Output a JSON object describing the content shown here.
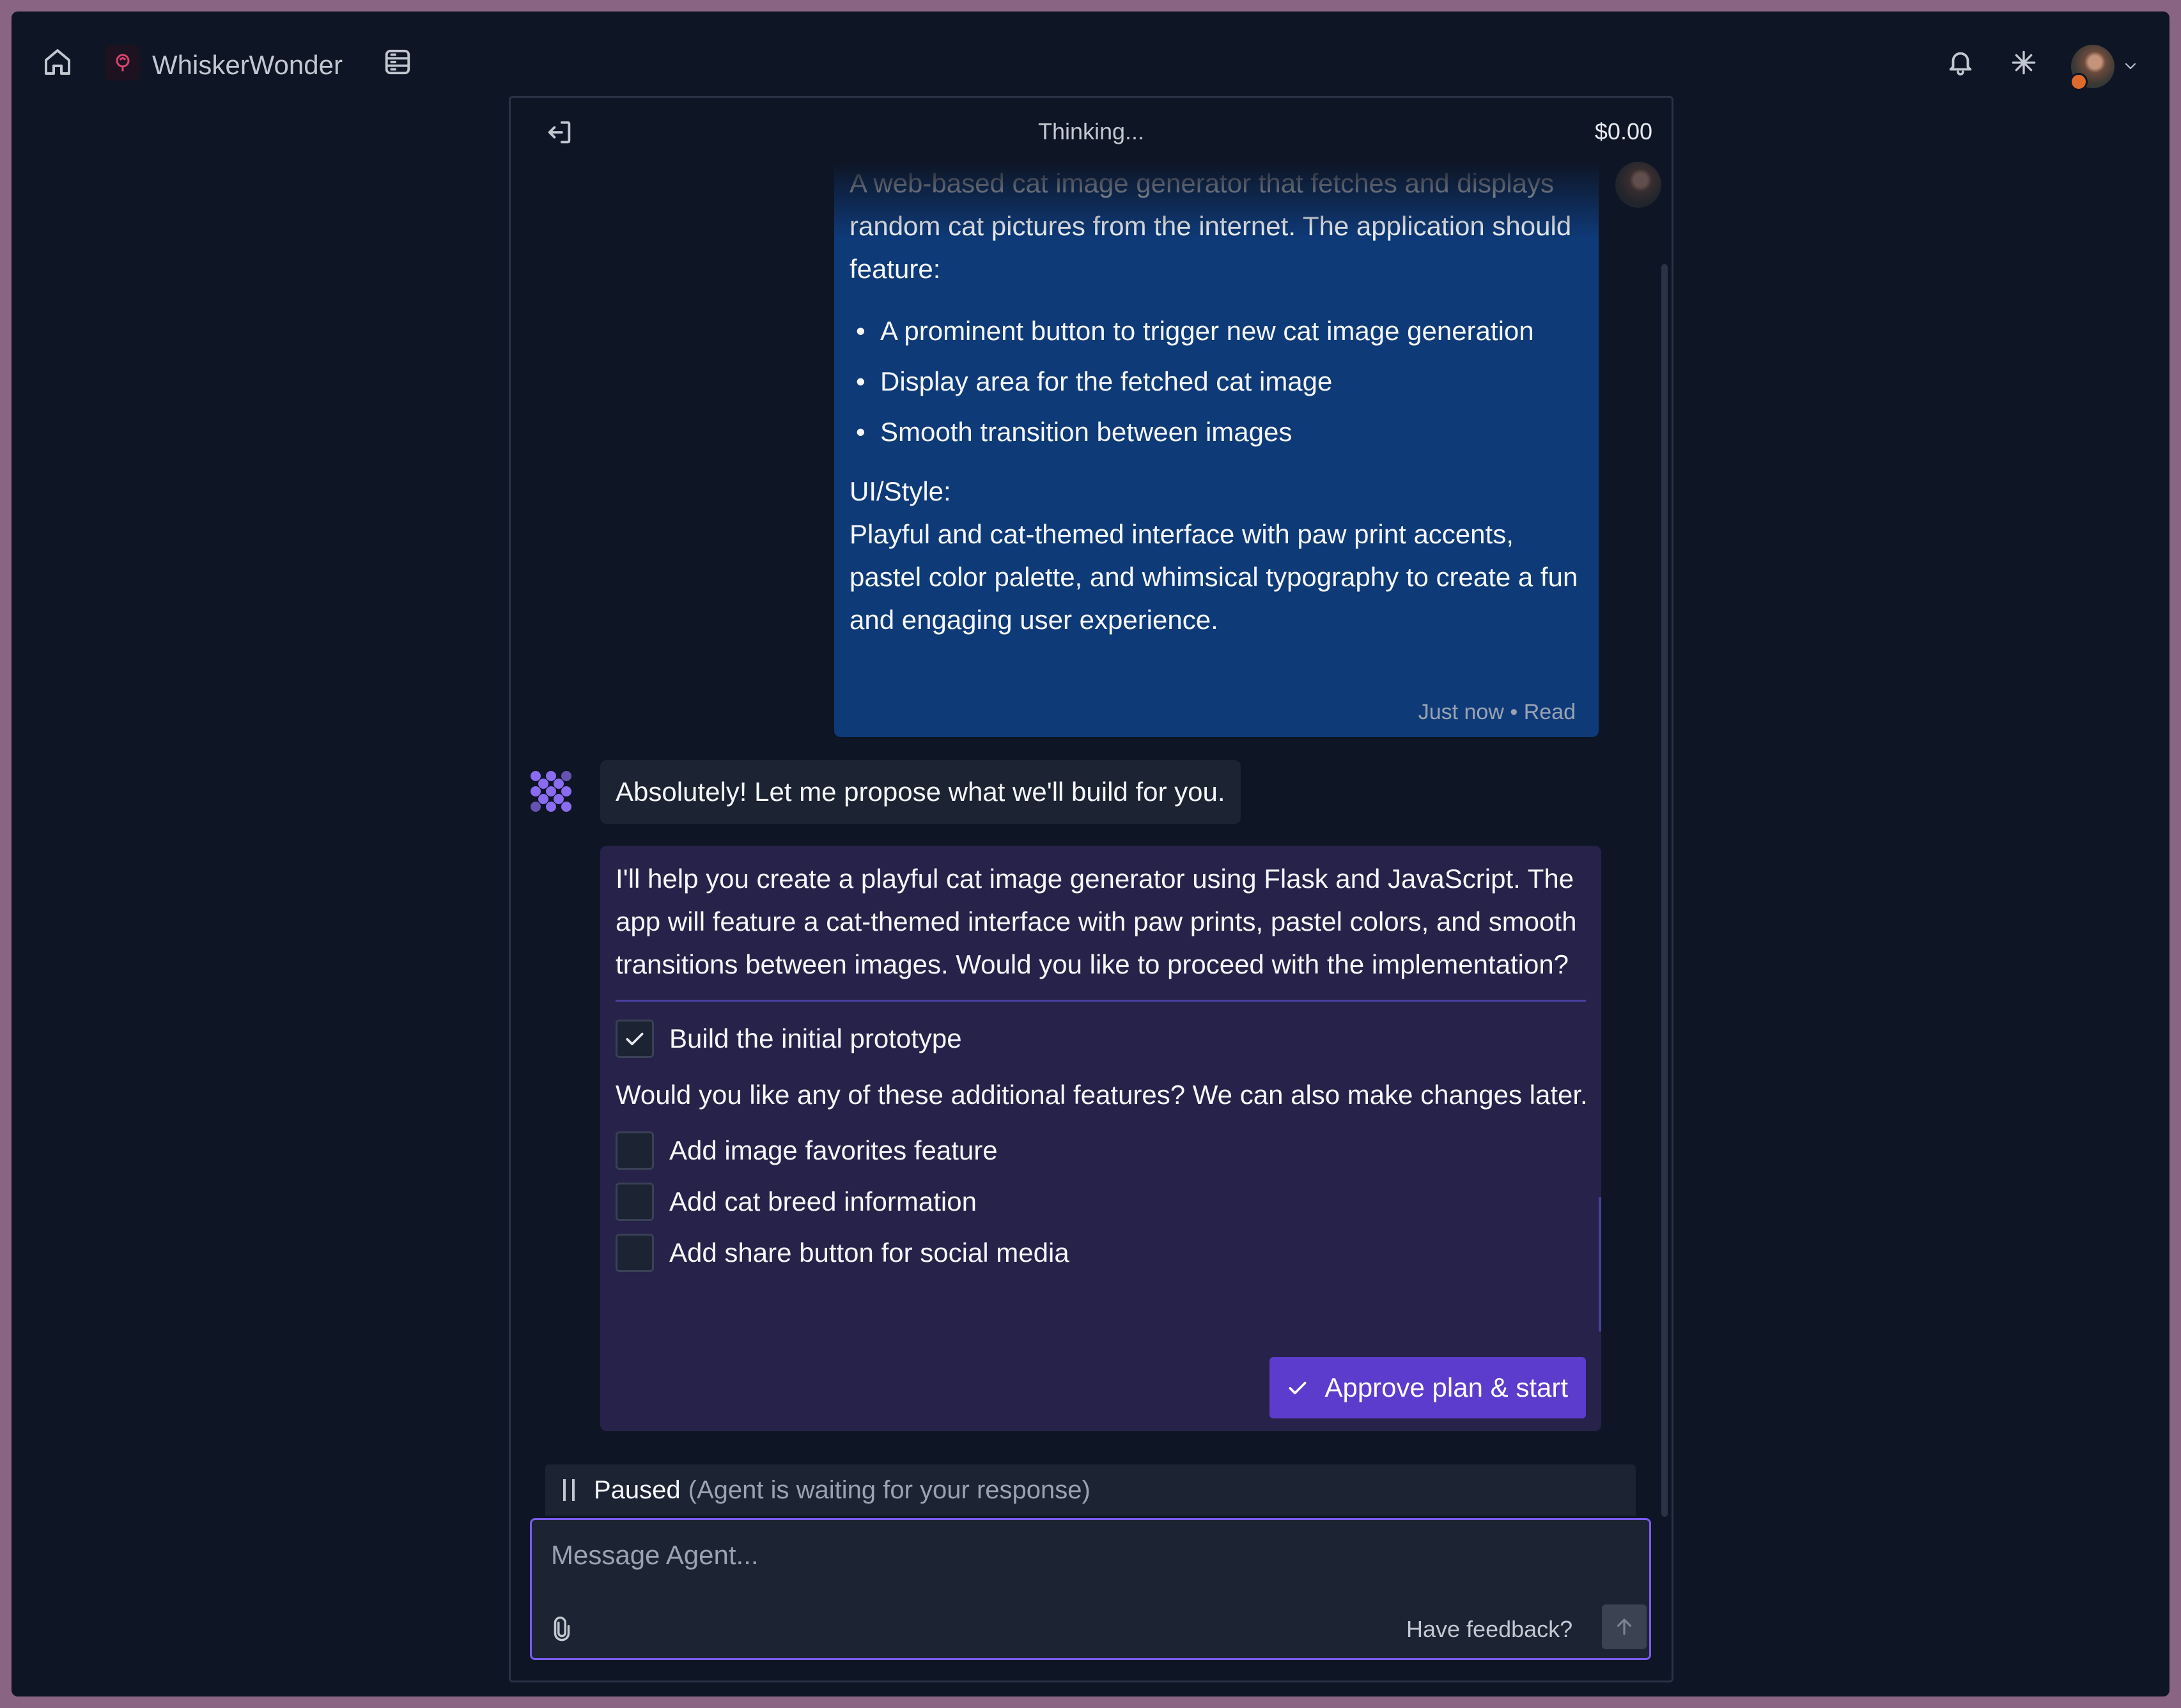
{
  "app": {
    "name": "WhiskerWonder"
  },
  "panel": {
    "status": "Thinking...",
    "cost": "$0.00"
  },
  "user_message": {
    "intro": "A web-based cat image generator that fetches and displays random cat pictures from the internet. The application should feature:",
    "features": [
      "A prominent button to trigger new cat image generation",
      "Display area for the fetched cat image",
      "Smooth transition between images"
    ],
    "style_heading": "UI/Style:",
    "style_text": "Playful and cat-themed interface with paw print accents, pastel color palette, and whimsical typography to create a fun and engaging user experience.",
    "time": "Just now",
    "status": "Read"
  },
  "agent": {
    "reply": "Absolutely! Let me propose what we'll build for you.",
    "plan_intro": "I'll help you create a playful cat image generator using Flask and JavaScript. The app will feature a cat-themed interface with paw prints, pastel colors, and smooth transitions between images. Would you like to proceed with the implementation?",
    "primary_option": {
      "label": "Build the initial prototype",
      "checked": true
    },
    "additional_question": "Would you like any of these additional features? We can also make changes later.",
    "options": [
      {
        "label": "Add image favorites feature",
        "checked": false
      },
      {
        "label": "Add cat breed information",
        "checked": false
      },
      {
        "label": "Add share button for social media",
        "checked": false
      }
    ],
    "approve_label": "Approve plan & start"
  },
  "status_bar": {
    "label": "Paused",
    "detail": "(Agent is waiting for your response)"
  },
  "composer": {
    "placeholder": "Message Agent...",
    "feedback_label": "Have feedback?"
  },
  "colors": {
    "accent": "#5b3ccc",
    "user_bubble": "#0e3a78",
    "plan_bg": "#262249",
    "background": "#0e1525"
  }
}
